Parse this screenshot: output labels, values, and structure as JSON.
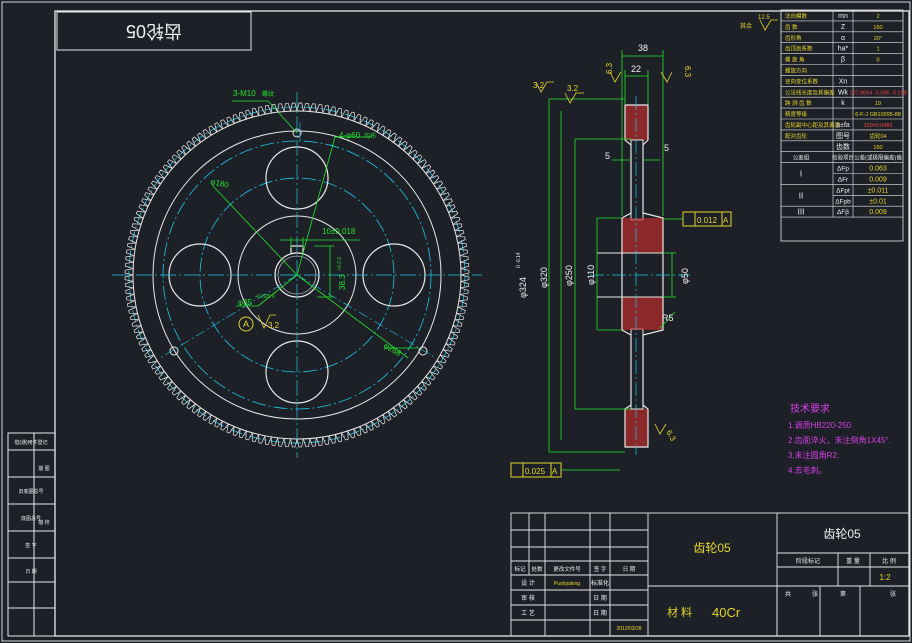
{
  "title_box": {
    "text": "齿轮05"
  },
  "roughness_corner": {
    "value": "12.5",
    "label": "其余"
  },
  "params": {
    "rows": [
      {
        "name": "法向模数",
        "sym": "mn",
        "val": "2"
      },
      {
        "name": "齿 数",
        "sym": "Z",
        "val": "160"
      },
      {
        "name": "齿形角",
        "sym": "α",
        "val": "20°"
      },
      {
        "name": "齿顶高系数",
        "sym": "ha*",
        "val": "1"
      },
      {
        "name": "螺 旋 角",
        "sym": "β",
        "val": "0"
      },
      {
        "name": "螺旋方向",
        "sym": "",
        "val": ""
      },
      {
        "name": "径向变位系数",
        "sym": "Xn",
        "val": ""
      },
      {
        "name": "公法线长度及其偏差",
        "sym": "Wk",
        "val": "107.8064 -0.096 -0.158"
      },
      {
        "name": "跨 测 齿 数",
        "sym": "k",
        "val": "19"
      },
      {
        "name": "精度等级",
        "sym": "",
        "val": "6-F-J GB10095-88"
      },
      {
        "name": "齿轮副中心距及其偏差",
        "sym": "a±fa",
        "val": "320±0.0485"
      },
      {
        "name": "配对齿轮",
        "sym": "图号",
        "val": "齿轮04"
      },
      {
        "name": "",
        "sym": "齿数",
        "val": "160"
      }
    ],
    "group_header": {
      "a": "公差组",
      "b": "检验项目",
      "c": "公差(或极限偏差)值"
    },
    "groups": [
      {
        "grp": "I",
        "items": [
          {
            "sym": "ΔFp",
            "val": "0.063"
          },
          {
            "sym": "ΔFr",
            "val": "0.009"
          }
        ]
      },
      {
        "grp": "II",
        "items": [
          {
            "sym": "ΔFpt",
            "val": "±0.011"
          },
          {
            "sym": "ΔFpb",
            "val": "±0.01"
          }
        ]
      },
      {
        "grp": "III",
        "items": [
          {
            "sym": "ΔFβ",
            "val": "0.009"
          }
        ]
      }
    ],
    "red_cells": [
      "107.8064",
      "320±0.0485"
    ]
  },
  "front_view": {
    "label_m10": "3-M10",
    "label_m10_suffix": "螺纹",
    "label_holes": "4-φ60",
    "label_holes_suffix": "均布",
    "dia_180": "φ180",
    "key_width": "10±0.018",
    "key_depth": "38.3",
    "key_depth_tol": "+0.2 0",
    "bore": "φ35",
    "bore_tol": "+0.025 0",
    "datum": "A",
    "rough_bore": "3.2",
    "dia_268": "φ268"
  },
  "section_view": {
    "width_total": "38",
    "width_rim": "22",
    "rough_left": "6.3",
    "rough_right": "6.3",
    "rough_a": "3.2",
    "rough_b": "3.2",
    "gap_l": "5",
    "gap_r": "5",
    "dia_tip": "φ324",
    "dia_tip_tol": "0 -0.14",
    "dia_320": "φ320",
    "dia_250": "φ250",
    "dia_110": "φ110",
    "dia_50": "φ50",
    "radius": "R5",
    "runout_top": "0.012",
    "runout_bottom": "0.025",
    "datum": "A",
    "rough_bottom": "6.3"
  },
  "tech_req": {
    "title": "技术要求",
    "lines": [
      "1.调质HB220-250",
      "2.齿面淬火，未注倒角1X45°.",
      "3.未注圆角R2;",
      "4.去毛刺。"
    ]
  },
  "left_strip": [
    "借(通)用件登记",
    "",
    "旧底图总号",
    "底图总号",
    "签 字",
    "日 期"
  ],
  "left_strip_small": [
    "",
    "描 图",
    "",
    "描 校",
    "",
    ""
  ],
  "title_block": {
    "drawing_name": "齿轮05",
    "part_name": "齿轮05",
    "material_label": "材 料",
    "material": "40Cr",
    "header_cells": [
      "标记",
      "处数",
      "更改文件号",
      "签 字",
      "日 期"
    ],
    "rows": [
      {
        "a": "设 计",
        "b": "Pushpaking",
        "c": "标准化",
        "d": ""
      },
      {
        "a": "审 核",
        "b": "",
        "c": "日 期",
        "d": ""
      },
      {
        "a": "工 艺",
        "b": "",
        "c": "日 期",
        "d": "2012/03/28"
      }
    ],
    "stage_mark": "阶段标记",
    "weight": "重 量",
    "scale_label": "比 例",
    "scale": "1:2",
    "sheet_total": "共",
    "sheet_label": "张",
    "sheet_no": "第",
    "sheet_label2": "张"
  }
}
